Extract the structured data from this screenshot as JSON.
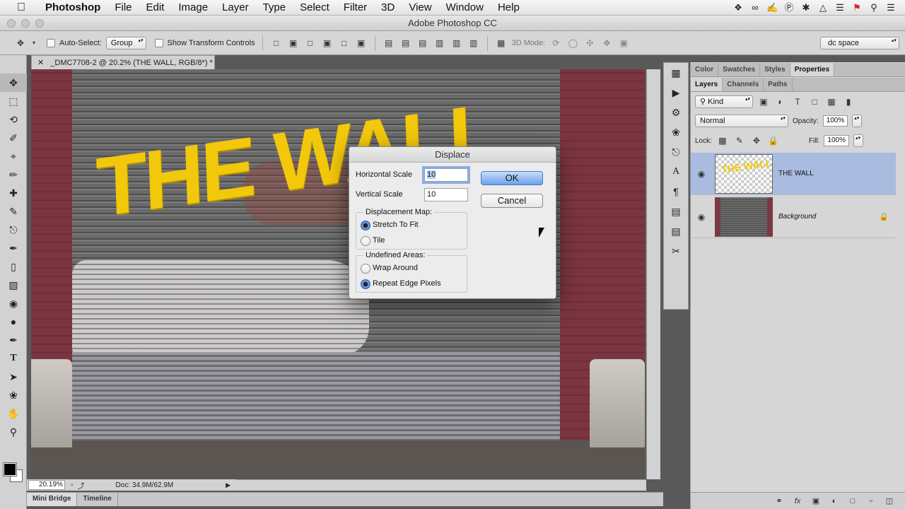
{
  "menubar": {
    "apple_icon": "apple-logo-icon",
    "items": [
      "Photoshop",
      "File",
      "Edit",
      "Image",
      "Layer",
      "Type",
      "Select",
      "Filter",
      "3D",
      "View",
      "Window",
      "Help"
    ],
    "status_icons": [
      "dropbox-icon",
      "creative-cloud-icon",
      "evernote-icon",
      "paypal-icon",
      "bluetooth-icon",
      "airplay-icon",
      "wifi-icon",
      "canada-flag-icon",
      "spotlight-icon",
      "list-icon"
    ]
  },
  "window": {
    "title": "Adobe Photoshop CC"
  },
  "options": {
    "auto_select_label": "Auto-Select:",
    "group_value": "Group",
    "show_transform_label": "Show Transform Controls",
    "mode_3d_label": "3D Mode:",
    "workspace_value": "dc space"
  },
  "document": {
    "tab_label": "_DMC7708-2 @ 20.2% (THE WALL, RGB/8*) *",
    "artwork_text": "THE WALL"
  },
  "statusbar": {
    "zoom": "20.19%",
    "doc_size": "Doc: 34.9M/62.9M"
  },
  "bottom_tabs": [
    "Mini Bridge",
    "Timeline"
  ],
  "panels": {
    "top_tabs": [
      "Color",
      "Swatches",
      "Styles",
      "Properties"
    ],
    "layer_tabs": [
      "Layers",
      "Channels",
      "Paths"
    ],
    "filter_kind": "Kind",
    "blend_mode": "Normal",
    "opacity_label": "Opacity:",
    "opacity_value": "100%",
    "lock_label": "Lock:",
    "fill_label": "Fill:",
    "fill_value": "100%",
    "layers": [
      {
        "name": "THE WALL",
        "thumb_text": "THE WALL"
      },
      {
        "name": "Background"
      }
    ]
  },
  "dialog": {
    "title": "Displace",
    "horizontal_scale_label": "Horizontal Scale",
    "horizontal_scale_value": "10",
    "vertical_scale_label": "Vertical Scale",
    "vertical_scale_value": "10",
    "displacement_map_label": "Displacement Map:",
    "stretch_label": "Stretch To Fit",
    "tile_label": "Tile",
    "undefined_areas_label": "Undefined Areas:",
    "wrap_label": "Wrap Around",
    "repeat_label": "Repeat Edge Pixels",
    "ok_label": "OK",
    "cancel_label": "Cancel"
  },
  "colors": {
    "accent": "#6ba2ee",
    "artwork_yellow": "#f2c80b",
    "selected_layer": "#a9bbdf"
  }
}
